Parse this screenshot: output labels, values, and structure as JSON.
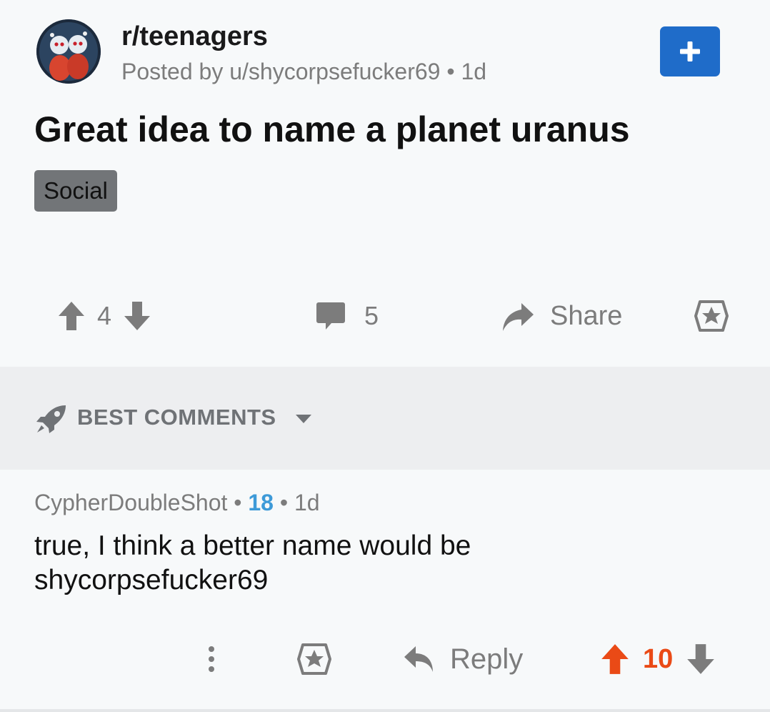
{
  "post": {
    "subreddit": "r/teenagers",
    "posted_by": "Posted by u/shycorpsefucker69",
    "age": "1d",
    "title": "Great idea to name a planet uranus",
    "flair": "Social",
    "vote_count": "4",
    "comment_count": "5",
    "share_label": "Share"
  },
  "comments_section": {
    "sort_label": "BEST COMMENTS"
  },
  "comment": {
    "author": "CypherDoubleShot",
    "score": "18",
    "age": "1d",
    "body_line1": "true, I think a better name would be",
    "body_line2": "shycorpsefucker69",
    "reply_label": "Reply",
    "upvotes": "10"
  },
  "colors": {
    "accent_blue": "#1f6cc9",
    "upvote_orange": "#ea4a16",
    "score_blue": "#3d9ad8",
    "icon_gray": "#7c7c7c"
  },
  "icons": [
    "subreddit-avatar",
    "plus-icon",
    "upvote-icon",
    "downvote-icon",
    "comment-icon",
    "share-icon",
    "award-icon",
    "rocket-icon",
    "caret-down-icon",
    "more-icon",
    "reply-icon"
  ]
}
